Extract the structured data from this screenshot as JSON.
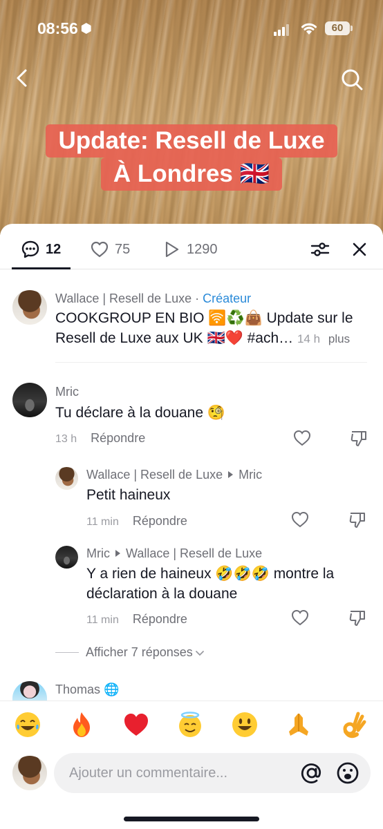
{
  "status_bar": {
    "time": "08:56",
    "battery": "60"
  },
  "video": {
    "title_line1": "Update: Resell de Luxe",
    "title_line2": "À Londres 🇬🇧"
  },
  "tabs": {
    "comments_count": "12",
    "likes_count": "75",
    "views_count": "1290"
  },
  "comments": {
    "creator": {
      "name": "Wallace | Resell de Luxe",
      "separator": " · ",
      "badge": "Créateur",
      "text": "COOKGROUP EN BIO 🛜♻️👜 Update sur le Resell de Luxe aux UK 🇬🇧❤️ #ach…",
      "time": "14 h",
      "more": "plus"
    },
    "c1": {
      "name": "Mric",
      "text": "Tu déclare à la douane 🧐",
      "time": "13 h",
      "reply": "Répondre"
    },
    "r1": {
      "name": "Wallace | Resell de Luxe",
      "to": "Mric",
      "text": "Petit haineux",
      "time": "11 min",
      "reply": "Répondre"
    },
    "r2": {
      "name": "Mric",
      "to": "Wallace | Resell de Luxe",
      "text": "Y a rien de haineux 🤣🤣🤣 montre la déclaration à la douane",
      "time": "11 min",
      "reply": "Répondre"
    },
    "show_replies": "Afficher 7 réponses",
    "c2": {
      "name": "Thomas 🌐"
    }
  },
  "emoji_bar": [
    "😂",
    "🔥",
    "❤️",
    "😇",
    "😃",
    "🙏",
    "👌"
  ],
  "composer": {
    "placeholder": "Ajouter un commentaire..."
  },
  "colors": {
    "accent_blue": "#2a8ad8",
    "title_bg": "#e76252"
  }
}
